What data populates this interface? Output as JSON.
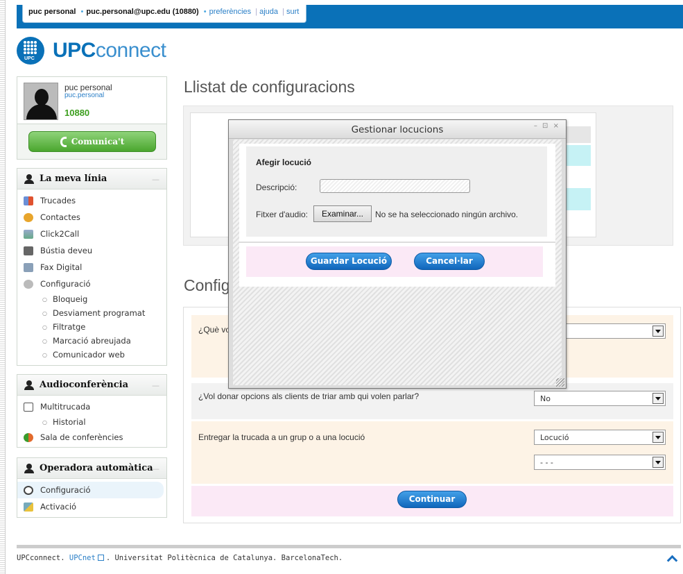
{
  "topbar": {
    "user_name": "puc personal",
    "user_email": "puc.personal@upc.edu (10880)",
    "link_preferences": "preferències",
    "link_help": "ajuda",
    "link_logout": "surt"
  },
  "logo": {
    "small": "UPC",
    "brand_bold": "UPC",
    "brand_light": "connect"
  },
  "profile": {
    "name": "puc personal",
    "username": "puc.personal",
    "extension": "10880",
    "comunica_label": "Comunica't"
  },
  "sidebar": {
    "linia": {
      "title": "La meva línia",
      "items": [
        "Trucades",
        "Contactes",
        "Click2Call",
        "Bústia deveu",
        "Fax Digital",
        "Configuració"
      ],
      "subitems": [
        "Bloqueig",
        "Desviament programat",
        "Filtratge",
        "Marcació abreujada",
        "Comunicador web"
      ]
    },
    "audio": {
      "title": "Audioconferència",
      "items": [
        "Multitrucada",
        "Sala de conferències"
      ],
      "subitems": [
        "Historial"
      ]
    },
    "operadora": {
      "title": "Operadora automàtica",
      "items": [
        "Configuració",
        "Activació"
      ]
    }
  },
  "main": {
    "title": "Llistat de configuracions",
    "title2_partial": "Config",
    "q1_partial": "¿Què vo",
    "q2": "¿Vol donar opcions als clients de triar amb qui volen parlar?",
    "q2_value": "No",
    "q3": "Entregar la trucada a un grup o a una locució",
    "q3_value": "Locució",
    "q3_value2": "- - -",
    "continue_label": "Continuar"
  },
  "modal": {
    "title": "Gestionar locucions",
    "controls": "– ⊡ ×",
    "form_title": "Afegir locució",
    "desc_label": "Descripció:",
    "file_label": "Fitxer d'audio:",
    "file_button": "Examinar...",
    "file_status": "No se ha seleccionado ningún archivo.",
    "save_label": "Guardar Locució",
    "cancel_label": "Cancel·lar"
  },
  "footer": {
    "brand": "UPCconnect.",
    "link": "UPCnet",
    "rest": ". Universitat Politècnica de Catalunya. BarcelonaTech."
  },
  "colors": {
    "brand_blue": "#0a71b8",
    "green": "#4aa62e",
    "button_blue": "#1066bb",
    "cyan_row": "#c6f2f5",
    "peach_row": "#fdf3e6",
    "pink_row": "#fbe9f6"
  }
}
